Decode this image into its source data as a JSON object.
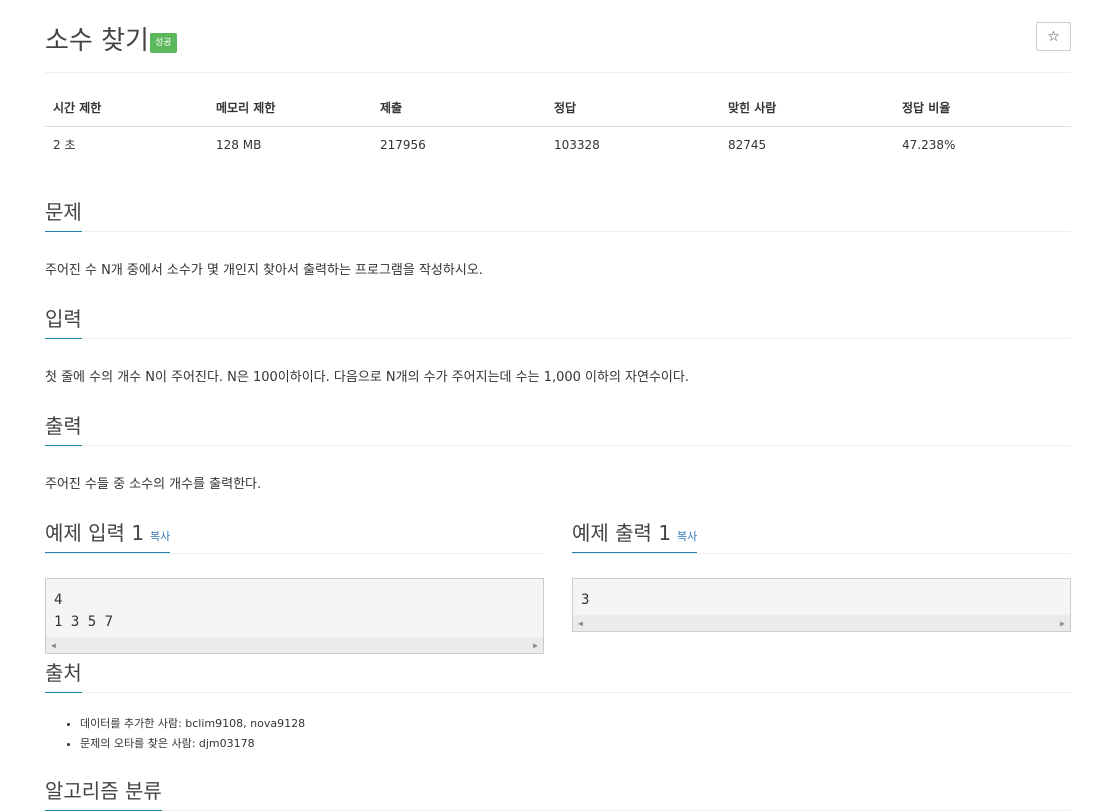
{
  "problem": {
    "title": "소수 찾기",
    "badge": "성공",
    "star_icon": "☆"
  },
  "info": {
    "headers": [
      "시간 제한",
      "메모리 제한",
      "제출",
      "정답",
      "맞힌 사람",
      "정답 비율"
    ],
    "values": [
      "2 초",
      "128 MB",
      "217956",
      "103328",
      "82745",
      "47.238%"
    ]
  },
  "sections": {
    "problem": {
      "title": "문제",
      "text": "주어진 수 N개 중에서 소수가 몇 개인지 찾아서 출력하는 프로그램을 작성하시오."
    },
    "input": {
      "title": "입력",
      "text": "첫 줄에 수의 개수 N이 주어진다. N은 100이하이다. 다음으로 N개의 수가 주어지는데 수는 1,000 이하의 자연수이다."
    },
    "output": {
      "title": "출력",
      "text": "주어진 수들 중 소수의 개수를 출력한다."
    }
  },
  "samples": {
    "input": {
      "title": "예제 입력 1",
      "copy": "복사",
      "content": "4\n1 3 5 7"
    },
    "output": {
      "title": "예제 출력 1",
      "copy": "복사",
      "content": "3"
    }
  },
  "source": {
    "title": "출처",
    "items": [
      "데이터를 추가한 사람: bclim9108, nova9128",
      "문제의 오타를 찾은 사람: djm03178"
    ]
  },
  "algorithm": {
    "title": "알고리즘 분류"
  }
}
